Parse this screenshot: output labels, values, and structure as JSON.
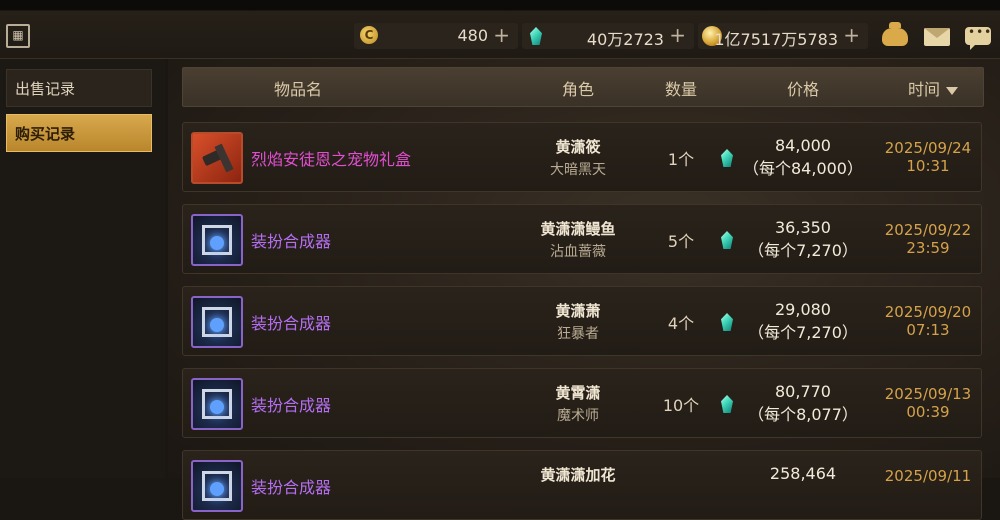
{
  "topbar": {
    "calendar_icon": "calendar-icon",
    "currencies": [
      {
        "icon": "coin-c-icon",
        "value": "480",
        "plus": "+"
      },
      {
        "icon": "gem-icon",
        "value": "40万2723",
        "plus": "+"
      },
      {
        "icon": "gold-coin-icon",
        "value": "1亿7517万5783",
        "plus": "+"
      }
    ],
    "icons": [
      "bag-icon",
      "mail-icon",
      "chat-icon"
    ]
  },
  "sidebar": {
    "items": [
      {
        "label": "出售记录",
        "active": false
      },
      {
        "label": "购买记录",
        "active": true
      }
    ]
  },
  "table": {
    "headers": {
      "item": "物品名",
      "role": "角色",
      "qty": "数量",
      "price": "价格",
      "time": "时间"
    },
    "rows": [
      {
        "icon": "gift-box-icon",
        "name": "烈焰安徒恩之宠物礼盒",
        "name_color": "#e14fd0",
        "role_name": "黄潇筱",
        "role_class": "大暗黑天",
        "qty": "1个",
        "price": "84,000",
        "unit": "（每个84,000）",
        "date": "2025/09/24",
        "time": "10:31"
      },
      {
        "icon": "synthesizer-icon",
        "name": "装扮合成器",
        "name_color": "#b46ef0",
        "role_name": "黄潇潇鳗鱼",
        "role_class": "沾血蔷薇",
        "qty": "5个",
        "price": "36,350",
        "unit": "（每个7,270）",
        "date": "2025/09/22",
        "time": "23:59"
      },
      {
        "icon": "synthesizer-icon",
        "name": "装扮合成器",
        "name_color": "#b46ef0",
        "role_name": "黄潇萧",
        "role_class": "狂暴者",
        "qty": "4个",
        "price": "29,080",
        "unit": "（每个7,270）",
        "date": "2025/09/20",
        "time": "07:13"
      },
      {
        "icon": "synthesizer-icon",
        "name": "装扮合成器",
        "name_color": "#b46ef0",
        "role_name": "黄霄潇",
        "role_class": "魔术师",
        "qty": "10个",
        "price": "80,770",
        "unit": "（每个8,077）",
        "date": "2025/09/13",
        "time": "00:39"
      },
      {
        "icon": "synthesizer-icon",
        "name": "装扮合成器",
        "name_color": "#b46ef0",
        "role_name": "黄潇潇加花",
        "role_class": "",
        "qty": "",
        "price": "258,464",
        "unit": "",
        "date": "2025/09/11",
        "time": ""
      }
    ]
  },
  "colors": {
    "accent": "#d5a24a",
    "purple_item": "#b46ef0",
    "magenta_item": "#e14fd0",
    "gem": "#3fd6b8"
  }
}
